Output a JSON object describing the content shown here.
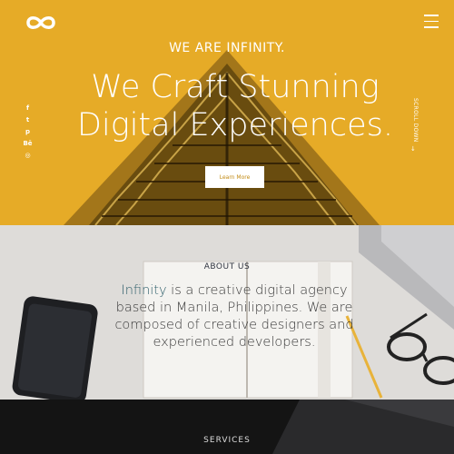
{
  "brand": {
    "logo_icon": "infinity-logo-icon"
  },
  "nav": {
    "menu_icon": "hamburger-menu-icon"
  },
  "hero": {
    "eyebrow": "WE ARE INFINITY.",
    "headline_line1": "We Craft Stunning",
    "headline_line2": "Digital Experiences.",
    "cta_label": "Learn More",
    "scroll_label": "SCROLL DOWN",
    "scroll_icon": "arrow-down-icon",
    "background_color": "#e6ab27"
  },
  "social": [
    {
      "name": "facebook-icon",
      "glyph": "f"
    },
    {
      "name": "twitter-icon",
      "glyph": "t"
    },
    {
      "name": "pinterest-icon",
      "glyph": "p"
    },
    {
      "name": "behance-icon",
      "glyph": "Bē"
    },
    {
      "name": "instagram-icon",
      "glyph": "◎"
    }
  ],
  "about": {
    "title": "ABOUT US",
    "accent_word": "Infinity",
    "body": " is a creative digital agency based in Manila, Philippines. We are composed of creative designers and experienced developers."
  },
  "services": {
    "title": "SERVICES"
  }
}
